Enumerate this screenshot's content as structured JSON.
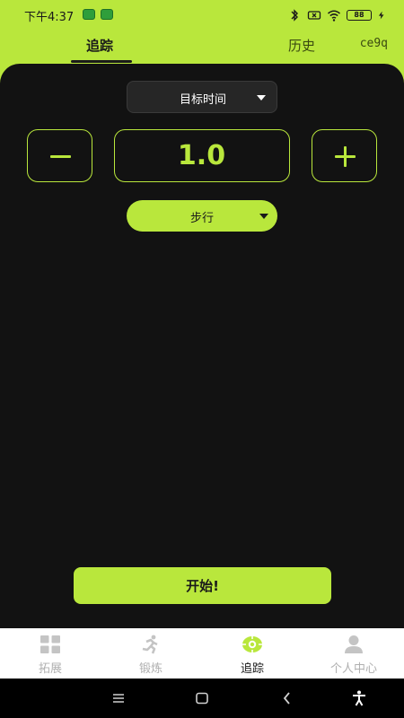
{
  "status_bar": {
    "time": "下午4:37",
    "battery": "88"
  },
  "top_tabs": {
    "items": [
      {
        "label": "追踪",
        "active": true
      },
      {
        "label": "历史",
        "active": false
      }
    ],
    "user": "ce9q"
  },
  "tracker": {
    "target_dropdown": {
      "selected": "目标时间"
    },
    "value": "1.0",
    "mode_dropdown": {
      "selected": "步行"
    },
    "start_label": "开始!"
  },
  "bottom_nav": {
    "items": [
      {
        "label": "拓展",
        "icon": "grid-icon",
        "active": false
      },
      {
        "label": "锻炼",
        "icon": "running-icon",
        "active": false
      },
      {
        "label": "追踪",
        "icon": "target-icon",
        "active": true
      },
      {
        "label": "个人中心",
        "icon": "person-icon",
        "active": false
      }
    ]
  },
  "colors": {
    "accent": "#b9e73c",
    "background": "#121212",
    "nav_active": "#1a1a1a",
    "nav_inactive": "#b0b0b0"
  }
}
